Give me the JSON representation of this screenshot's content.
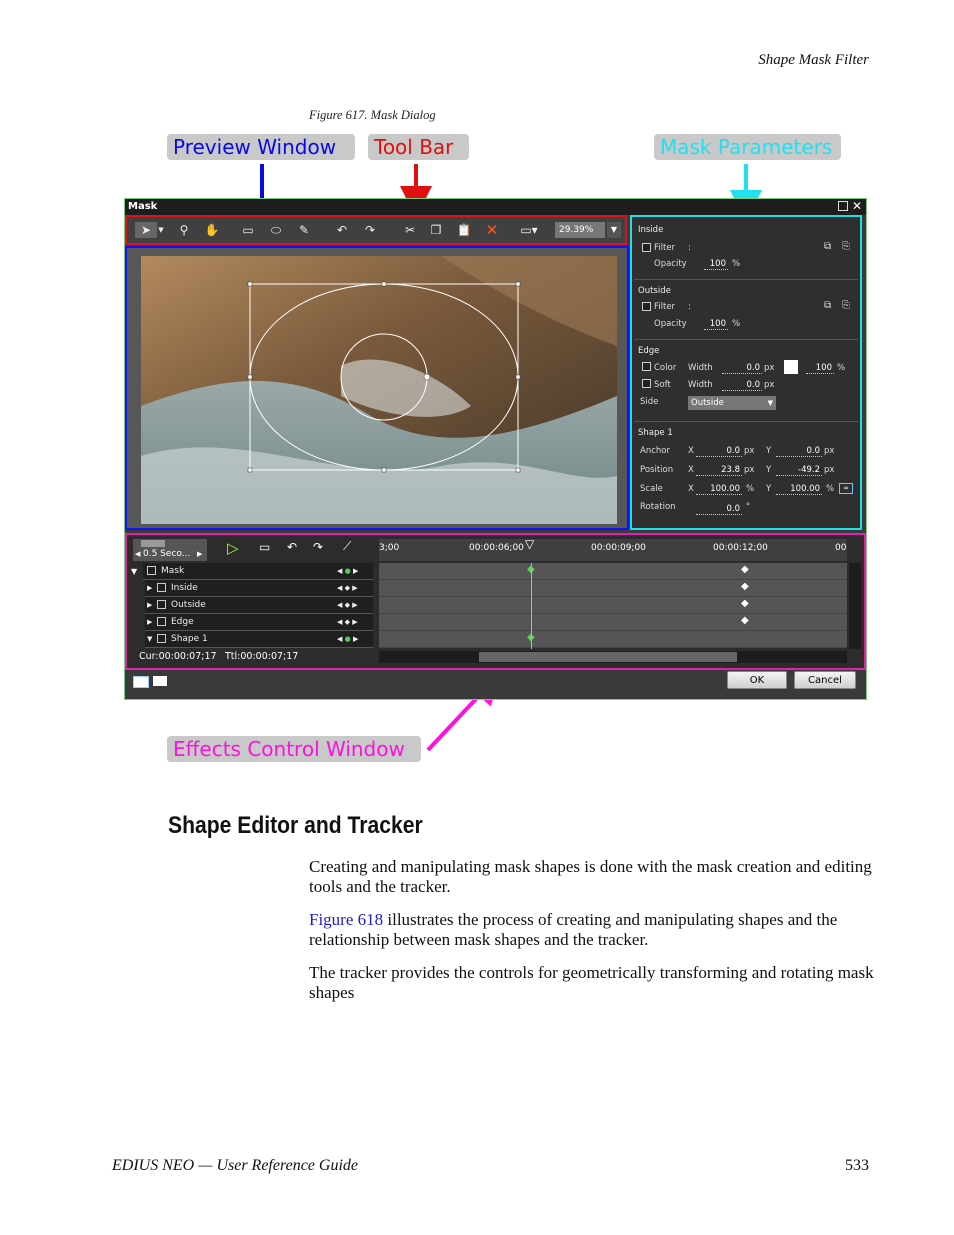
{
  "header": {
    "running_title": "Shape Mask Filter"
  },
  "figure": {
    "caption": "Figure 617.  Mask Dialog"
  },
  "callouts": {
    "preview": {
      "label": "Preview Window",
      "color": "#0a0ae6"
    },
    "toolbar": {
      "label": "Tool Bar",
      "color": "#e01010"
    },
    "params": {
      "label": "Mask Parameters",
      "color": "#22e0f0"
    },
    "effects": {
      "label": "Effects Control Window",
      "color": "#ff10e0"
    }
  },
  "dialog": {
    "title": "Mask",
    "zoom": "29.39%",
    "toolbar_icons": [
      "select-arrow-icon",
      "zoom-icon",
      "hand-icon",
      "rectangle-icon",
      "ellipse-icon",
      "pen-icon",
      "undo-icon",
      "redo-icon",
      "cut-icon",
      "copy-icon",
      "paste-icon",
      "delete-icon",
      "frame-icon"
    ],
    "params": {
      "inside": {
        "title": "Inside",
        "filter_label": "Filter",
        "colon": ":",
        "opacity_label": "Opacity",
        "opacity": "100",
        "unit": "%"
      },
      "outside": {
        "title": "Outside",
        "filter_label": "Filter",
        "colon": ":",
        "opacity_label": "Opacity",
        "opacity": "100",
        "unit": "%"
      },
      "edge": {
        "title": "Edge",
        "color_label": "Color",
        "soft_label": "Soft",
        "width_label": "Width",
        "color_width": "0.0",
        "soft_width": "0.0",
        "px": "px",
        "pct_value": "100",
        "pct": "%",
        "side_label": "Side",
        "side_value": "Outside"
      },
      "shape": {
        "title": "Shape 1",
        "anchor_label": "Anchor",
        "position_label": "Position",
        "scale_label": "Scale",
        "rotation_label": "Rotation",
        "x": "X",
        "y": "Y",
        "anchor_x": "0.0",
        "anchor_y": "0.0",
        "pos_x": "23.8",
        "pos_y": "-49.2",
        "scale_x": "100.00",
        "scale_y": "100.00",
        "rotation": "0.0",
        "px": "px",
        "pct": "%",
        "deg": "°"
      }
    },
    "effects": {
      "step": "0.5 Seco...",
      "tracks": [
        {
          "label": "Mask",
          "indent": 0
        },
        {
          "label": "Inside",
          "indent": 1
        },
        {
          "label": "Outside",
          "indent": 1
        },
        {
          "label": "Edge",
          "indent": 1
        },
        {
          "label": "Shape 1",
          "indent": 1
        }
      ],
      "timecodes": [
        "3;00",
        "00:00:06;00",
        "00:00:09;00",
        "00:00:12;00",
        "00"
      ],
      "cur": "Cur:00:00:07;17",
      "ttl": "Ttl:00:00:07;17"
    },
    "ok_label": "OK",
    "cancel_label": "Cancel"
  },
  "section": {
    "heading": "Shape Editor and Tracker",
    "p1": "Creating and manipulating mask shapes is done with the mask creation and editing tools and the tracker.",
    "p2_link": "Figure 618",
    "p2_rest": " illustrates the process of creating and manipulating shapes and the relationship between mask shapes and the tracker.",
    "p3": "The tracker provides the controls for geometrically transforming and rotating mask shapes"
  },
  "footer": {
    "guide": "EDIUS NEO  —  User Reference Guide",
    "page": "533"
  }
}
